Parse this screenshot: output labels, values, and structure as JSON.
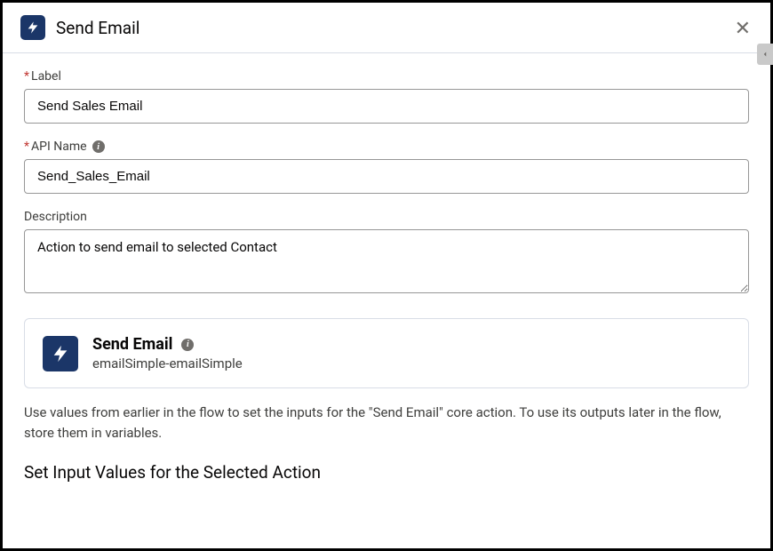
{
  "header": {
    "title": "Send Email"
  },
  "fields": {
    "label": {
      "label": "Label",
      "value": "Send Sales Email",
      "required": true
    },
    "apiName": {
      "label": "API Name",
      "value": "Send_Sales_Email",
      "required": true
    },
    "description": {
      "label": "Description",
      "value": "Action to send email to selected Contact",
      "required": false
    }
  },
  "actionCard": {
    "title": "Send Email",
    "subtitle": "emailSimple-emailSimple"
  },
  "helperText": "Use values from earlier in the flow to set the inputs for the \"Send Email\" core action. To use its outputs later in the flow, store them in variables.",
  "sectionHeading": "Set Input Values for the Selected Action"
}
